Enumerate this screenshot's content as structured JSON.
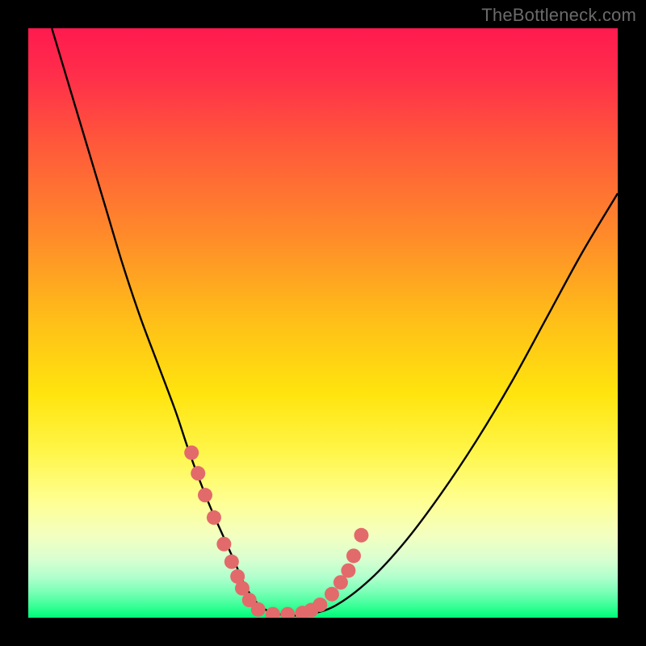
{
  "watermark": "TheBottleneck.com",
  "colors": {
    "frame_bg": "#000000",
    "curve": "#000000",
    "marker_fill": "#e36a6a",
    "marker_stroke": "#d85a5a",
    "gradient_stops": [
      {
        "offset": 0.0,
        "color": "#ff1a4f"
      },
      {
        "offset": 0.08,
        "color": "#ff2e4a"
      },
      {
        "offset": 0.2,
        "color": "#ff5a3a"
      },
      {
        "offset": 0.35,
        "color": "#ff8a2a"
      },
      {
        "offset": 0.5,
        "color": "#ffc018"
      },
      {
        "offset": 0.62,
        "color": "#ffe40e"
      },
      {
        "offset": 0.72,
        "color": "#fff64a"
      },
      {
        "offset": 0.8,
        "color": "#ffff90"
      },
      {
        "offset": 0.86,
        "color": "#f3ffc0"
      },
      {
        "offset": 0.9,
        "color": "#d9ffd0"
      },
      {
        "offset": 0.93,
        "color": "#b2ffcd"
      },
      {
        "offset": 0.955,
        "color": "#7dffb8"
      },
      {
        "offset": 0.975,
        "color": "#48ff9e"
      },
      {
        "offset": 0.99,
        "color": "#1aff86"
      },
      {
        "offset": 1.0,
        "color": "#00f57a"
      }
    ]
  },
  "chart_data": {
    "type": "line",
    "title": "",
    "xlabel": "",
    "ylabel": "",
    "xlim": [
      0,
      100
    ],
    "ylim": [
      0,
      100
    ],
    "note": "Axes unlabeled; values estimated from pixel positions as percent of plot area. y=0 is bottom (green), y=100 is top (red).",
    "series": [
      {
        "name": "bottleneck-curve",
        "x": [
          4,
          7,
          10,
          13,
          16,
          19,
          22,
          25,
          27,
          29,
          31,
          33,
          35,
          36.5,
          38,
          40,
          43,
          47,
          52,
          58,
          64,
          70,
          76,
          82,
          88,
          94,
          100
        ],
        "y": [
          100,
          90,
          80,
          70,
          60,
          51,
          43,
          35,
          29,
          23.5,
          18.5,
          14,
          9.5,
          6,
          3.5,
          1.5,
          0.5,
          0.5,
          2,
          6.5,
          13,
          21,
          30,
          40,
          51,
          62,
          72
        ]
      }
    ],
    "markers": {
      "name": "highlighted-points",
      "x": [
        27.7,
        28.8,
        30.0,
        31.5,
        33.2,
        34.5,
        35.5,
        36.3,
        37.5,
        39.0,
        41.5,
        44.0,
        46.5,
        48.0,
        49.5,
        51.5,
        53.0,
        54.3,
        55.2,
        56.5
      ],
      "y": [
        28.0,
        24.5,
        20.8,
        17.0,
        12.5,
        9.5,
        7.0,
        5.0,
        3.0,
        1.4,
        0.6,
        0.6,
        0.8,
        1.3,
        2.2,
        4.0,
        6.0,
        8.0,
        10.5,
        14.0
      ]
    }
  }
}
